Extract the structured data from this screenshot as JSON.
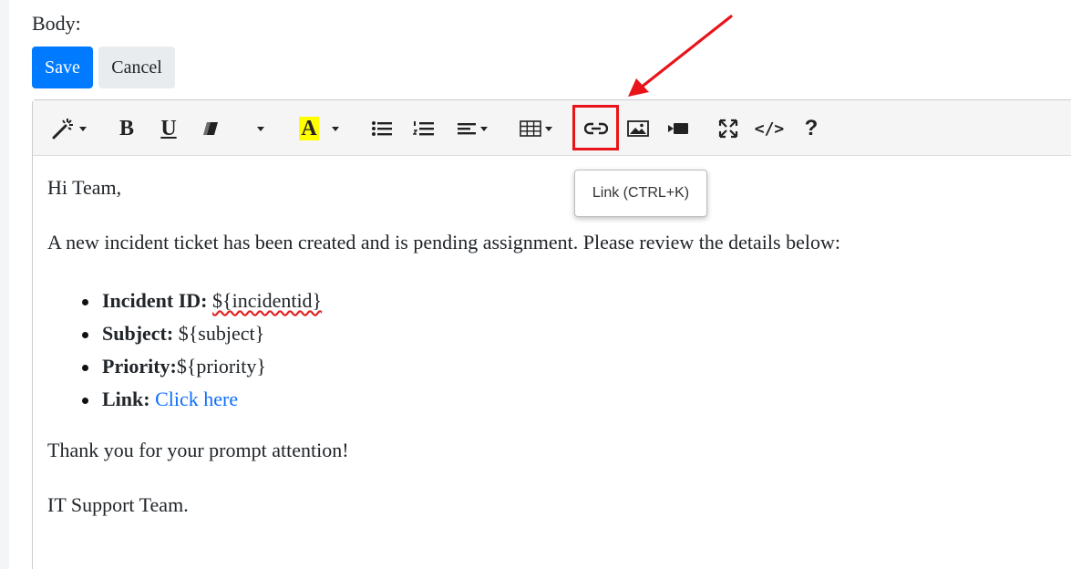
{
  "form": {
    "body_label": "Body:",
    "save_label": "Save",
    "cancel_label": "Cancel"
  },
  "toolbar": {
    "buttons": [
      {
        "name": "style-dropdown",
        "icon": "magic-wand-icon"
      },
      {
        "name": "bold",
        "icon": "bold-icon",
        "label": "B"
      },
      {
        "name": "underline",
        "icon": "underline-icon",
        "label": "U"
      },
      {
        "name": "clear-format",
        "icon": "eraser-icon"
      },
      {
        "name": "font-dropdown",
        "icon": "caret-down-icon"
      },
      {
        "name": "highlight",
        "icon": "highlight-icon",
        "label": "A"
      },
      {
        "name": "unordered-list",
        "icon": "bullet-list-icon"
      },
      {
        "name": "ordered-list",
        "icon": "numbered-list-icon"
      },
      {
        "name": "align",
        "icon": "align-icon"
      },
      {
        "name": "table",
        "icon": "table-icon"
      },
      {
        "name": "link",
        "icon": "link-icon"
      },
      {
        "name": "image",
        "icon": "image-icon"
      },
      {
        "name": "video",
        "icon": "video-icon"
      },
      {
        "name": "fullscreen",
        "icon": "expand-icon"
      },
      {
        "name": "code-view",
        "icon": "code-icon",
        "label": "</>"
      },
      {
        "name": "help",
        "icon": "help-icon",
        "label": "?"
      }
    ],
    "tooltip": "Link (CTRL+K)",
    "highlight_color": "#ffff00",
    "annotation_color": "#e8141a"
  },
  "content": {
    "greeting": "Hi Team,",
    "intro": "A new incident ticket has been created and is pending assignment. Please review the details below:",
    "items": [
      {
        "label": "Incident ID:",
        "value": "${incidentid}"
      },
      {
        "label": "Subject:",
        "value": "${subject}"
      },
      {
        "label": "Priority:",
        "value": "${priority}"
      },
      {
        "label": "Link:",
        "value": "Click here"
      }
    ],
    "thanks": "Thank you for your prompt attention!",
    "signature": "IT Support Team."
  },
  "colors": {
    "primary": "#007bff",
    "link": "#0d6efd",
    "secondary_bg": "#e9ecef"
  }
}
